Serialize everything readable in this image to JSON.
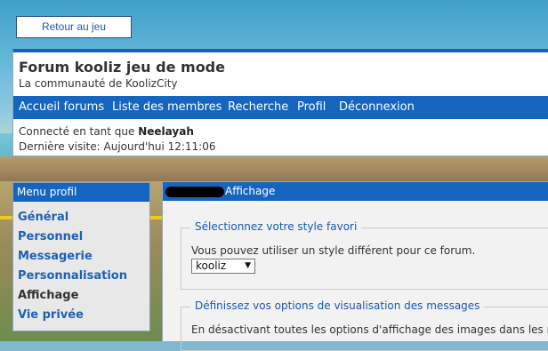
{
  "back_button": "Retour au jeu",
  "header": {
    "title": "Forum kooliz jeu de mode",
    "subtitle": "La communauté de KoolizCity",
    "nav": [
      "Accueil forums",
      "Liste des membres",
      "Recherche",
      "Profil",
      "Déconnexion"
    ],
    "connected_prefix": "Connecté en tant que",
    "username": "Neelayah",
    "last_visit": "Dernière visite: Aujourd'hui 12:11:06"
  },
  "sidebar": {
    "title": "Menu profil",
    "items": [
      "Général",
      "Personnel",
      "Messagerie",
      "Personnalisation",
      "Affichage",
      "Vie privée"
    ],
    "active": "Affichage"
  },
  "main": {
    "title": "Affichage",
    "section1": {
      "legend": "Sélectionnez votre style favori",
      "text": "Vous pouvez utiliser un style différent pour ce forum.",
      "selected_style": "kooliz"
    },
    "section2": {
      "legend": "Définissez vos options de visualisation des messages",
      "text": "En désactivant toutes les options d'affichage des images dans les m"
    }
  },
  "colors": {
    "accent": "#1565c0",
    "link": "#1d62b4"
  }
}
